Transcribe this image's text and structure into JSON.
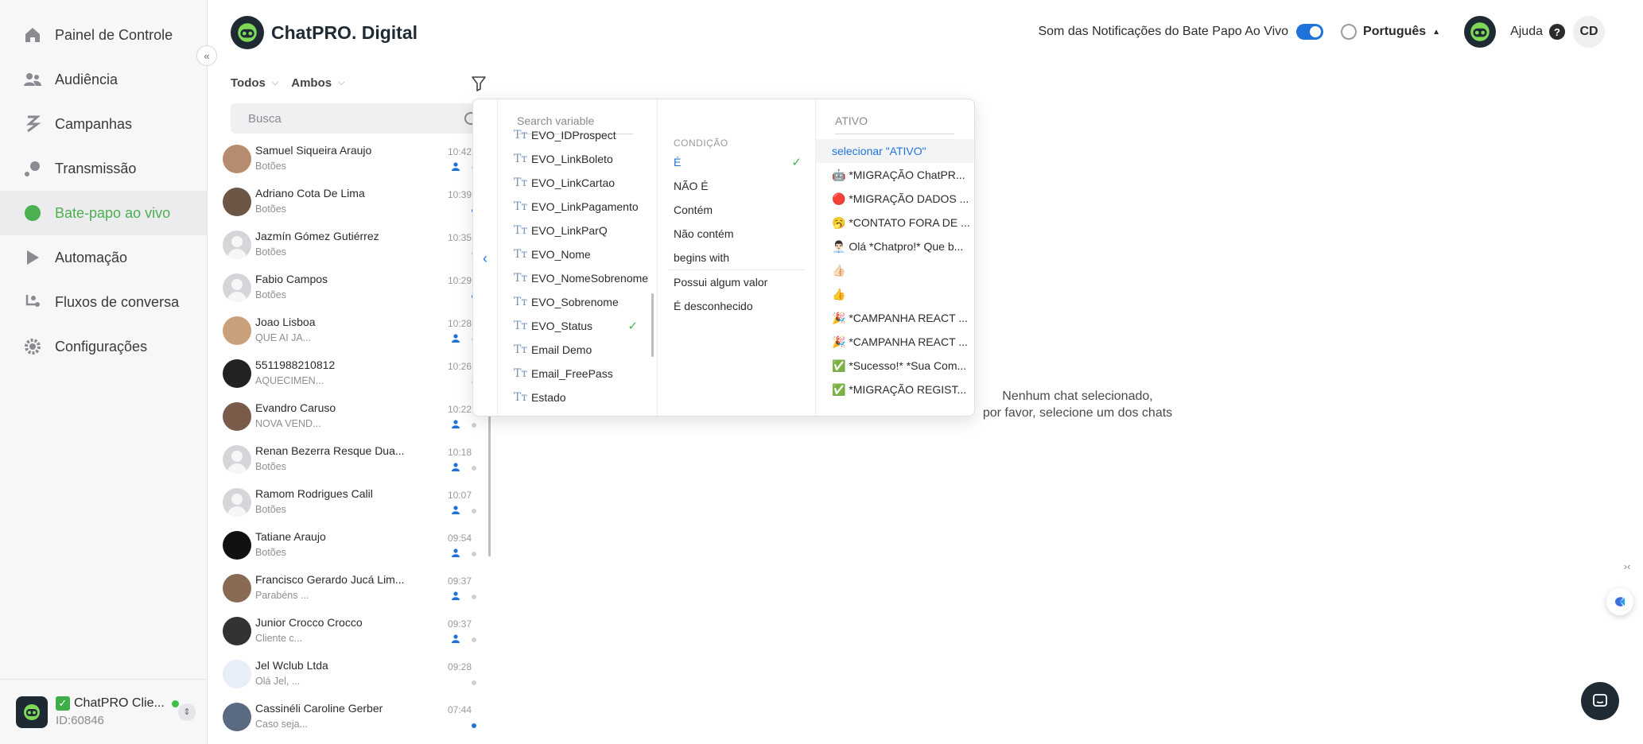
{
  "nav": [
    {
      "label": "Painel de Controle",
      "icon": "home-icon"
    },
    {
      "label": "Audiência",
      "icon": "users-icon"
    },
    {
      "label": "Campanhas",
      "icon": "campaign-icon"
    },
    {
      "label": "Transmissão",
      "icon": "broadcast-icon"
    },
    {
      "label": "Bate-papo ao vivo",
      "icon": "chat-icon"
    },
    {
      "label": "Automação",
      "icon": "automation-icon"
    },
    {
      "label": "Fluxos de conversa",
      "icon": "flow-icon"
    },
    {
      "label": "Configurações",
      "icon": "gear-icon"
    }
  ],
  "colors": {
    "active_nav": "#4caf50",
    "accent_blue": "#1f73d8",
    "dark": "#1f2b34"
  },
  "header": {
    "brand": "ChatPRO. Digital",
    "notif_label": "Som das Notificações do Bate Papo Ao Vivo",
    "language": "Português",
    "help": "Ajuda",
    "help_icon": "?",
    "user_initials": "CD"
  },
  "account": {
    "name": "ChatPRO Clie...",
    "id": "ID:60846"
  },
  "filters": {
    "status": "Todos",
    "type": "Ambos"
  },
  "search": {
    "placeholder": "Busca"
  },
  "chats": [
    {
      "name": "Samuel Siqueira Araujo",
      "sub": "Botões",
      "time": "10:42"
    },
    {
      "name": "Adriano Cota De Lima",
      "sub": "Botões",
      "time": "10:39"
    },
    {
      "name": "Jazmín Gómez Gutiérrez",
      "sub": "Botões",
      "time": "10:35"
    },
    {
      "name": "Fabio Campos",
      "sub": "Botões",
      "time": "10:29"
    },
    {
      "name": "Joao Lisboa",
      "sub": "QUE AI JA...",
      "time": "10:28"
    },
    {
      "name": "5511988210812",
      "sub": "AQUECIMEN...",
      "time": "10:26"
    },
    {
      "name": "Evandro Caruso",
      "sub": "NOVA VEND...",
      "time": "10:22"
    },
    {
      "name": "Renan Bezerra Resque Dua...",
      "sub": "Botões",
      "time": "10:18"
    },
    {
      "name": "Ramom Rodrigues Calil",
      "sub": "Botões",
      "time": "10:07"
    },
    {
      "name": "Tatiane Araujo",
      "sub": "Botões",
      "time": "09:54"
    },
    {
      "name": "Francisco Gerardo Jucá Lim...",
      "sub": "Parabéns ...",
      "time": "09:37"
    },
    {
      "name": "Junior Crocco Crocco",
      "sub": "Cliente c...",
      "time": "09:37"
    },
    {
      "name": "Jel Wclub Ltda",
      "sub": "Olá Jel, ...",
      "time": "09:28"
    },
    {
      "name": "Cassinéli Caroline Gerber",
      "sub": "Caso seja...",
      "time": "07:44"
    }
  ],
  "filter_panel": {
    "var_search_placeholder": "Search variable",
    "variables": [
      "EVO_IDProspect",
      "EVO_LinkBoleto",
      "EVO_LinkCartao",
      "EVO_LinkPagamento",
      "EVO_LinkParQ",
      "EVO_Nome",
      "EVO_NomeSobrenome",
      "EVO_Sobrenome",
      "EVO_Status",
      "Email Demo",
      "Email_FreePass",
      "Estado"
    ],
    "selected_variable": "EVO_Status",
    "condition_header": "CONDIÇÃO",
    "conditions": [
      "É",
      "NÃO É",
      "Contém",
      "Não contém",
      "begins with",
      "Possui algum valor",
      "É desconhecido"
    ],
    "selected_condition": "É",
    "value_search": "ATIVO",
    "values": [
      "selecionar \"ATIVO\"",
      "🤖 *MIGRAÇÃO ChatPR...",
      "🔴 *MIGRAÇÃO DADOS ...",
      "🥱 *CONTATO FORA DE ...",
      "👨🏻‍💼 Olá *Chatpro!* Que b...",
      "👍🏻",
      "👍",
      "🎉 *CAMPANHA REACT ...",
      "🎉 *CAMPANHA REACT ...",
      "✅ *Sucesso!* *Sua Com...",
      "✅ *MIGRAÇÃO REGIST..."
    ]
  },
  "empty_state": {
    "line1": "Nenhum chat selecionado,",
    "line2": "por favor, selecione um dos chats"
  }
}
